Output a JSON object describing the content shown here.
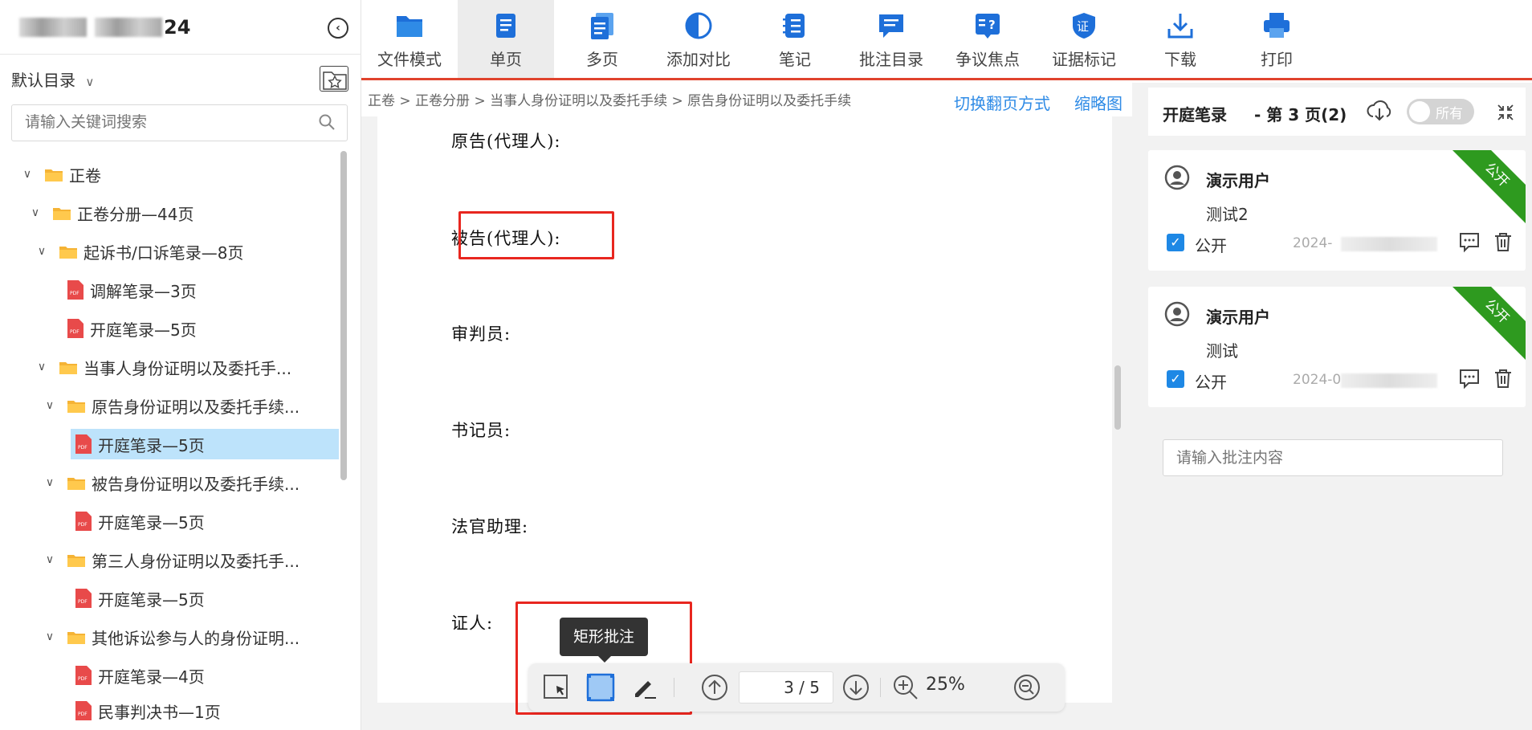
{
  "sidebar": {
    "case_title_suffix": "24",
    "collapse_icon": "‹",
    "directory_label": "默认目录",
    "search_placeholder": "请输入关键词搜索",
    "tree": [
      {
        "label": "正卷",
        "type": "folder",
        "expanded": true
      },
      {
        "label": "正卷分册—44页",
        "type": "folder",
        "expanded": true
      },
      {
        "label": "起诉书/口诉笔录—8页",
        "type": "folder",
        "expanded": true
      },
      {
        "label": "调解笔录—3页",
        "type": "pdf"
      },
      {
        "label": "开庭笔录—5页",
        "type": "pdf"
      },
      {
        "label": "当事人身份证明以及委托手...",
        "type": "folder",
        "expanded": true
      },
      {
        "label": "原告身份证明以及委托手续...",
        "type": "folder",
        "expanded": true
      },
      {
        "label": "开庭笔录—5页",
        "type": "pdf",
        "selected": true
      },
      {
        "label": "被告身份证明以及委托手续...",
        "type": "folder",
        "expanded": true
      },
      {
        "label": "开庭笔录—5页",
        "type": "pdf"
      },
      {
        "label": "第三人身份证明以及委托手...",
        "type": "folder",
        "expanded": true
      },
      {
        "label": "开庭笔录—5页",
        "type": "pdf"
      },
      {
        "label": "其他诉讼参与人的身份证明...",
        "type": "folder",
        "expanded": true
      },
      {
        "label": "开庭笔录—4页",
        "type": "pdf"
      },
      {
        "label": "民事判决书—1页",
        "type": "pdf"
      }
    ]
  },
  "toolbar": {
    "items": [
      {
        "label": "文件模式",
        "icon": "folder-icon"
      },
      {
        "label": "单页",
        "icon": "single-page-icon",
        "active": true
      },
      {
        "label": "多页",
        "icon": "multi-page-icon"
      },
      {
        "label": "添加对比",
        "icon": "compare-icon"
      },
      {
        "label": "笔记",
        "icon": "notes-icon"
      },
      {
        "label": "批注目录",
        "icon": "annotation-list-icon"
      },
      {
        "label": "争议焦点",
        "icon": "dispute-icon"
      },
      {
        "label": "证据标记",
        "icon": "evidence-icon"
      },
      {
        "label": "下载",
        "icon": "download-icon"
      },
      {
        "label": "打印",
        "icon": "print-icon"
      }
    ]
  },
  "breadcrumb": "正卷 > 正卷分册 > 当事人身份证明以及委托手续 > 原告身份证明以及委托手续",
  "links": {
    "switch_page_mode": "切换翻页方式",
    "thumbnails": "缩略图"
  },
  "document": {
    "lines": [
      "原告(代理人):",
      "被告(代理人):",
      "审判员:",
      "书记员:",
      "法官助理:",
      "证人:"
    ]
  },
  "annotation_toolbar": {
    "tooltip": "矩形批注",
    "page_indicator": "3 / 5",
    "zoom": "25%"
  },
  "notes_panel": {
    "title": "开庭笔录",
    "page_info": "- 第 3 页(2)",
    "filter_label": "所有",
    "ribbon_label": "公开",
    "cards": [
      {
        "user": "演示用户",
        "content": "测试2",
        "public_label": "公开",
        "date": "2024-"
      },
      {
        "user": "演示用户",
        "content": "测试",
        "public_label": "公开",
        "date": "2024-0"
      }
    ],
    "input_placeholder": "请输入批注内容"
  },
  "colors": {
    "accent_red": "#e0432d",
    "toolbar_blue": "#1e88e5",
    "selected_bg": "#bde3fb",
    "ribbon_green": "#2e9a1f",
    "link_blue": "#2f8be6"
  }
}
